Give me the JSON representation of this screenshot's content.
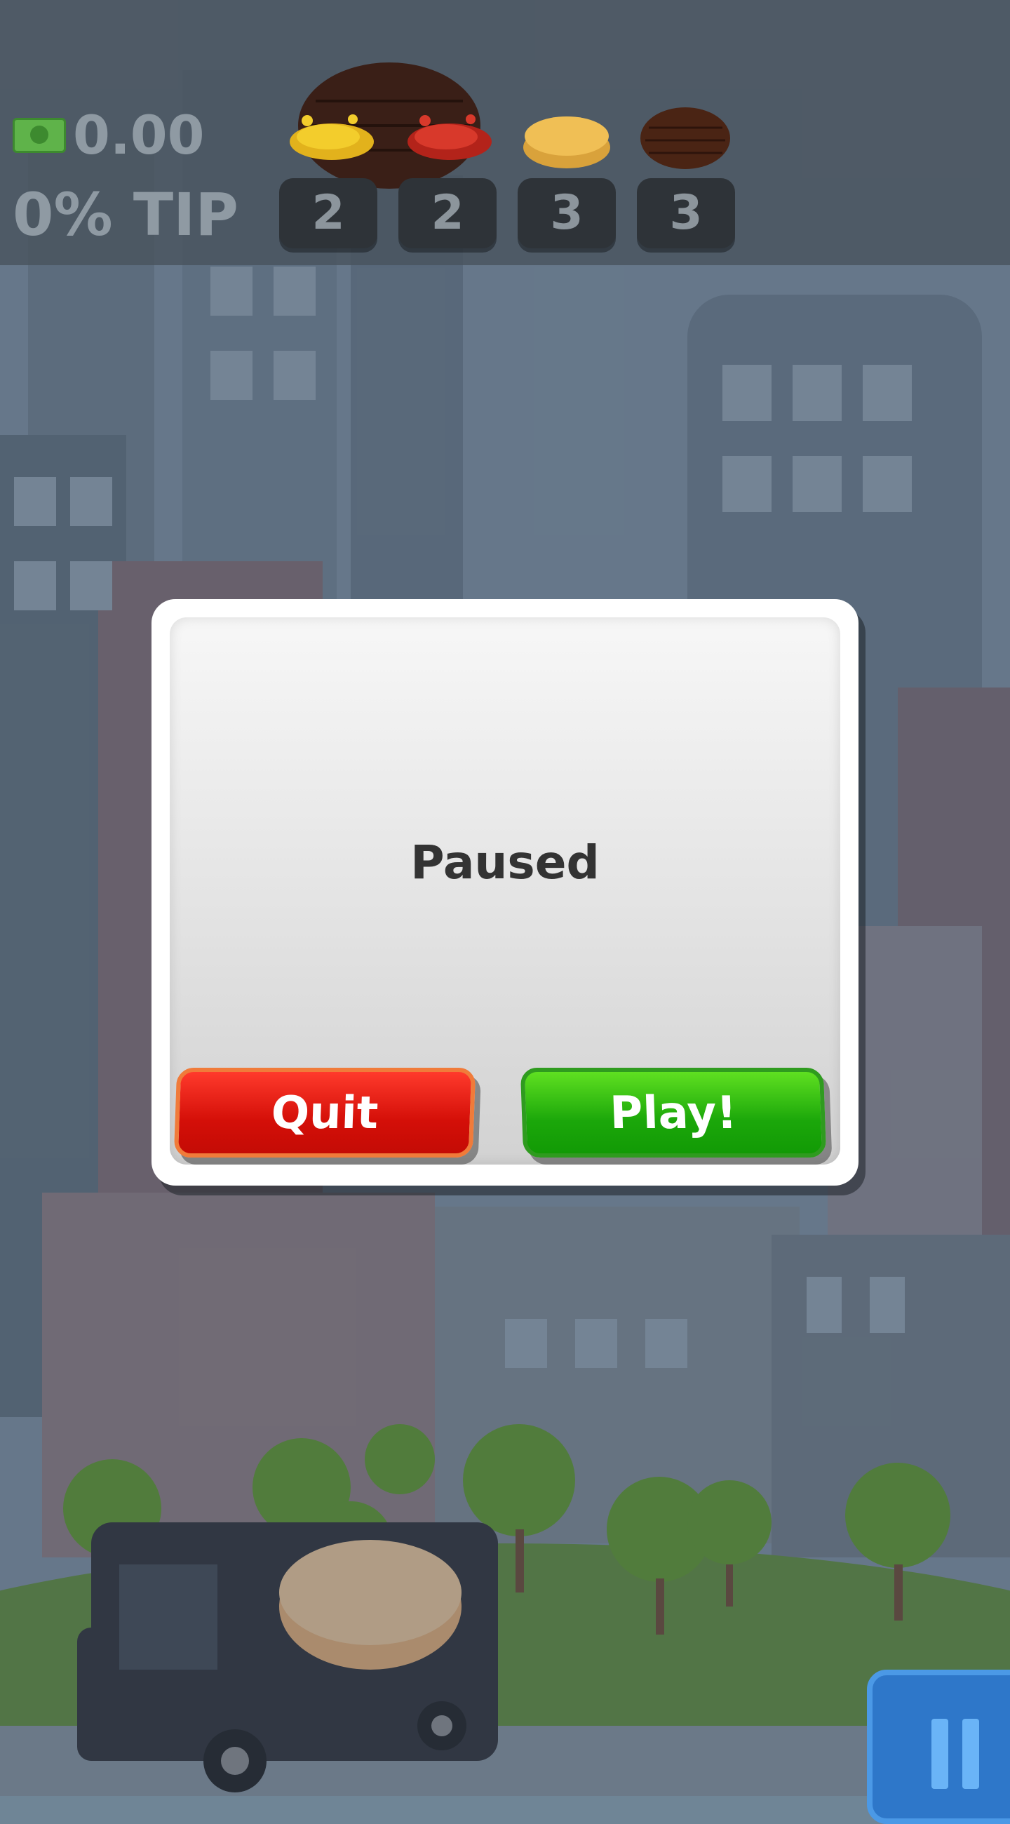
{
  "hud": {
    "money": "0.00",
    "tip": "0% TIP",
    "ingredients": [
      {
        "icon": "patty-with-mustard-icon",
        "count": "2"
      },
      {
        "icon": "ketchup-icon",
        "count": "2"
      },
      {
        "icon": "cheese-icon",
        "count": "3"
      },
      {
        "icon": "patty-icon",
        "count": "3"
      }
    ]
  },
  "dialog": {
    "title": "Paused",
    "quit_label": "Quit",
    "play_label": "Play!"
  },
  "colors": {
    "quit": "#d40f08",
    "play": "#1ba70a",
    "pause_button": "#2e77c9"
  }
}
